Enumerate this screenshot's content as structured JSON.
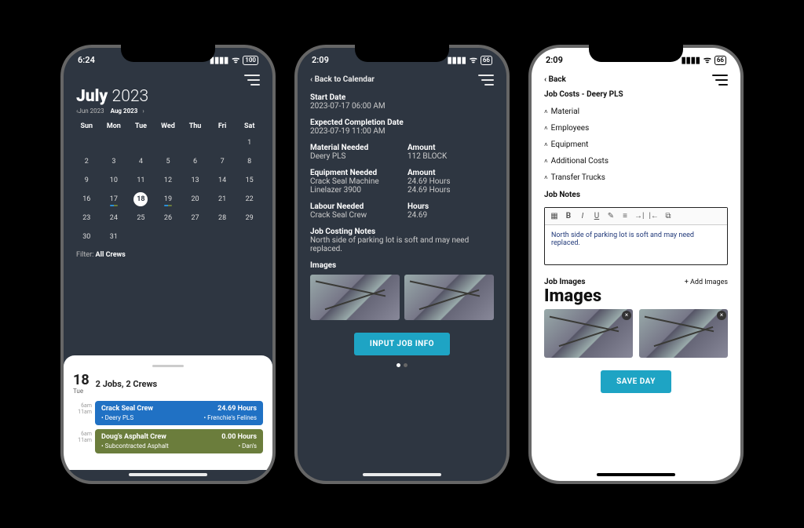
{
  "status": {
    "time1": "6:24",
    "time2": "2:09",
    "time3": "2:09",
    "battery": "100"
  },
  "colors": {
    "accent": "#1ea4c4",
    "job_blue": "#2071c4",
    "job_olive": "#6b7d3c"
  },
  "screen1": {
    "month": "July",
    "year": "2023",
    "prev": "Jun 2023",
    "next": "Aug 2023",
    "dow": [
      "Sun",
      "Mon",
      "Tue",
      "Wed",
      "Thu",
      "Fri",
      "Sat"
    ],
    "weeks": [
      [
        "",
        "",
        "",
        "",
        "",
        "",
        "1"
      ],
      [
        "2",
        "3",
        "4",
        "5",
        "6",
        "7",
        "8"
      ],
      [
        "9",
        "10",
        "11",
        "12",
        "13",
        "14",
        "15"
      ],
      [
        "16",
        "17",
        "18",
        "19",
        "20",
        "21",
        "22"
      ],
      [
        "23",
        "24",
        "25",
        "26",
        "27",
        "28",
        "29"
      ],
      [
        "30",
        "31",
        "",
        "",
        "",
        "",
        ""
      ]
    ],
    "selected": "18",
    "dotted": [
      "17",
      "19"
    ],
    "filter_label": "Filter:",
    "filter_value": "All Crews",
    "card": {
      "daynum": "18",
      "dayweek": "Tue",
      "summary": "2 Jobs, 2 Crews",
      "jobs": [
        {
          "time": "6am\n11am",
          "crew": "Crack Seal Crew",
          "hours": "24.69 Hours",
          "left": "• Deery PLS",
          "right": "• Frenchie's Felines",
          "cls": "blue"
        },
        {
          "time": "6am\n11am",
          "crew": "Doug's Asphalt Crew",
          "hours": "0.00 Hours",
          "left": "• Subcontracted Asphalt",
          "right": "• Dan's",
          "cls": "olive"
        }
      ]
    }
  },
  "screen2": {
    "back": "Back to Calendar",
    "start_l": "Start Date",
    "start_v": "2023-07-17 06:00 AM",
    "end_l": "Expected Completion Date",
    "end_v": "2023-07-19 11:00 AM",
    "mat_l": "Material Needed",
    "mat_v": "Deery PLS",
    "amt_l": "Amount",
    "mat_a": "112 BLOCK",
    "eq_l": "Equipment Needed",
    "eq": [
      {
        "n": "Crack Seal Machine",
        "h": "24.69 Hours"
      },
      {
        "n": "Linelazer 3900",
        "h": "24.69 Hours"
      }
    ],
    "lab_l": "Labour Needed",
    "lab_v": "Crack Seal Crew",
    "hrs_l": "Hours",
    "lab_h": "24.69",
    "notes_l": "Job Costing Notes",
    "notes_v": "North side of parking lot is soft and may need replaced.",
    "images_l": "Images",
    "cta": "INPUT JOB INFO"
  },
  "screen3": {
    "back": "Back",
    "title": "Job Costs - Deery PLS",
    "sections": [
      "Material",
      "Employees",
      "Equipment",
      "Additional Costs",
      "Transfer Trucks"
    ],
    "notes_l": "Job Notes",
    "notes_v": "North side of parking lot is soft and may need replaced.",
    "images_l": "Job Images",
    "images_h": "Images",
    "add": "+ Add Images",
    "cta": "SAVE DAY"
  }
}
